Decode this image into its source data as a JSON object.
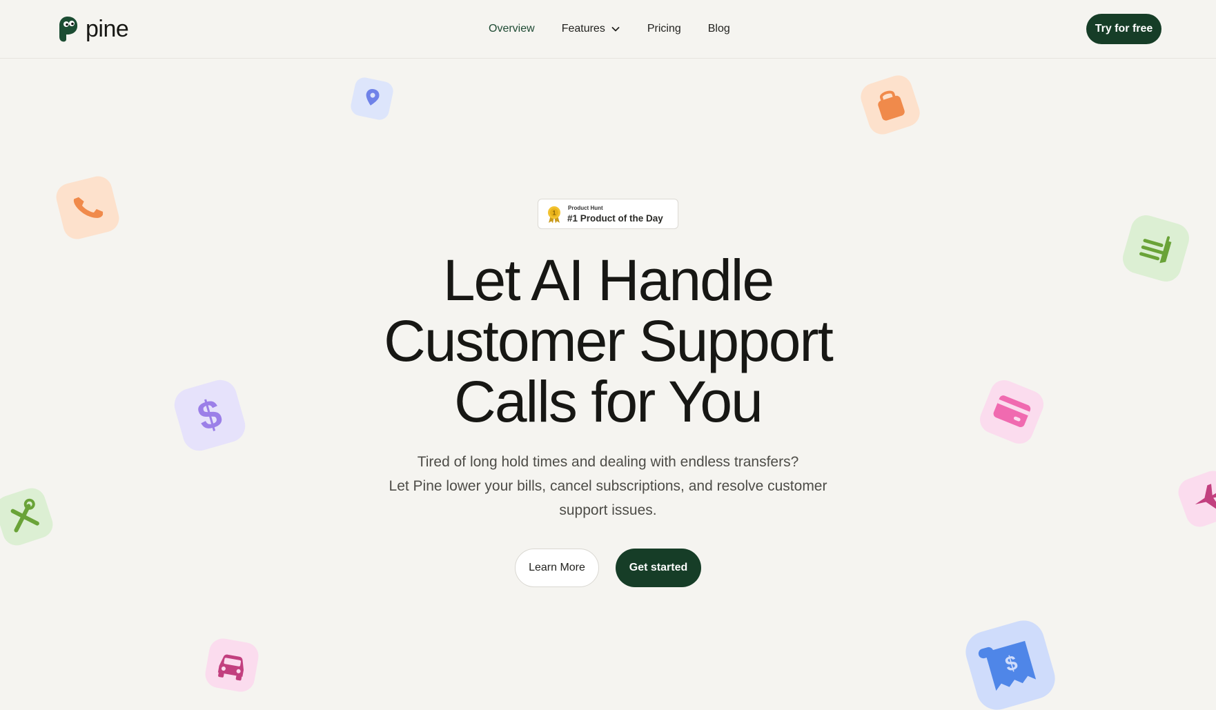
{
  "header": {
    "brand": "pine",
    "nav": [
      {
        "label": "Overview",
        "active": true
      },
      {
        "label": "Features",
        "has_dropdown": true
      },
      {
        "label": "Pricing"
      },
      {
        "label": "Blog"
      }
    ],
    "cta_label": "Try for free"
  },
  "badge": {
    "source": "Product Hunt",
    "title": "#1 Product of the Day"
  },
  "hero": {
    "headline_lines": [
      "Let AI Handle",
      "Customer Support",
      "Calls for You"
    ],
    "subtext_lines": [
      "Tired of long hold times and dealing with endless transfers?",
      "Let Pine lower your bills, cancel subscriptions, and resolve customer",
      "support issues."
    ],
    "learn_more_label": "Learn More",
    "get_started_label": "Get started"
  },
  "decor_icons": [
    "location-pin-icon",
    "shopping-bag-icon",
    "phone-icon",
    "food-delivery-icon",
    "dollar-icon",
    "credit-card-icon",
    "tools-icon",
    "airplane-icon",
    "car-icon",
    "receipt-icon"
  ],
  "colors": {
    "background": "#f5f4f0",
    "brand_dark_green": "#163d27",
    "text_dark": "#171714",
    "text_muted": "#4d4c47"
  }
}
